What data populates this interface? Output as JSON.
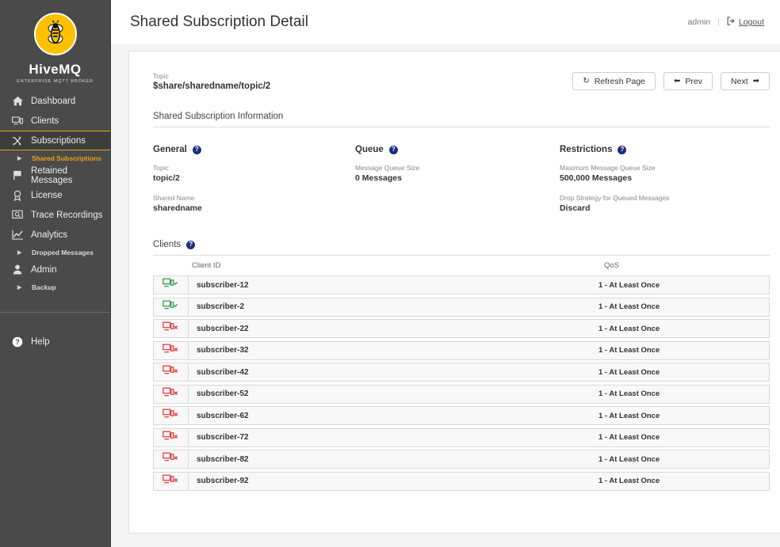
{
  "brand": {
    "name": "HiveMQ",
    "tagline": "ENTERPRISE MQTT BROKER",
    "logo_icon": "bee-logo-icon"
  },
  "sidebar": {
    "items": [
      {
        "label": "Dashboard",
        "icon": "home-icon",
        "active": false
      },
      {
        "label": "Clients",
        "icon": "monitor-icon",
        "active": false
      },
      {
        "label": "Subscriptions",
        "icon": "shuffle-icon",
        "active": true
      },
      {
        "label": "Retained Messages",
        "icon": "flag-icon",
        "active": false
      },
      {
        "label": "License",
        "icon": "award-icon",
        "active": false
      },
      {
        "label": "Trace Recordings",
        "icon": "search-document-icon",
        "active": false
      },
      {
        "label": "Analytics",
        "icon": "chart-line-icon",
        "active": false
      },
      {
        "label": "Admin",
        "icon": "user-icon",
        "active": false
      }
    ],
    "sub_shared_subscriptions": "Shared Subscriptions",
    "sub_dropped_messages": "Dropped Messages",
    "sub_backup": "Backup",
    "help": {
      "label": "Help",
      "icon": "help-circle-icon"
    },
    "accent_color": "#e8a317",
    "background_color": "#4a4a4a"
  },
  "header": {
    "title": "Shared Subscription Detail",
    "user": "admin",
    "separator": "|",
    "logout": "Logout",
    "logout_icon": "sign-out-icon"
  },
  "detail": {
    "topic_label": "Topic",
    "topic_value": "$share/sharedname/topic/2",
    "section_title": "Shared Subscription Information"
  },
  "toolbar": {
    "refresh_label": "Refresh Page",
    "refresh_icon": "refresh-icon",
    "prev_label": "Prev",
    "prev_icon": "arrow-left-icon",
    "next_label": "Next",
    "next_icon": "arrow-right-icon"
  },
  "general": {
    "title": "General",
    "help_icon": "help-circle-icon",
    "topic_label": "Topic",
    "topic_value": "topic/2",
    "shared_name_label": "Shared Name",
    "shared_name_value": "sharedname"
  },
  "queue": {
    "title": "Queue",
    "help_icon": "help-circle-icon",
    "message_queue_size_label": "Message Queue Size",
    "message_queue_size_value": "0 Messages"
  },
  "restrictions": {
    "title": "Restrictions",
    "help_icon": "help-circle-icon",
    "max_queue_size_label": "Maximum Message Queue Size",
    "max_queue_size_value": "500,000 Messages",
    "drop_strategy_label": "Drop Strategy for Queued Messages",
    "drop_strategy_value": "Discard"
  },
  "clients": {
    "title": "Clients",
    "help_icon": "help-circle-icon",
    "columns": {
      "client_id": "Client ID",
      "qos": "QoS"
    },
    "rows": [
      {
        "status": "connected",
        "status_icon": "device-connected-icon",
        "client_id": "subscriber-12",
        "qos": "1 - At Least Once"
      },
      {
        "status": "connected",
        "status_icon": "device-connected-icon",
        "client_id": "subscriber-2",
        "qos": "1 - At Least Once"
      },
      {
        "status": "disconnected",
        "status_icon": "device-disconnected-icon",
        "client_id": "subscriber-22",
        "qos": "1 - At Least Once"
      },
      {
        "status": "disconnected",
        "status_icon": "device-disconnected-icon",
        "client_id": "subscriber-32",
        "qos": "1 - At Least Once"
      },
      {
        "status": "disconnected",
        "status_icon": "device-disconnected-icon",
        "client_id": "subscriber-42",
        "qos": "1 - At Least Once"
      },
      {
        "status": "disconnected",
        "status_icon": "device-disconnected-icon",
        "client_id": "subscriber-52",
        "qos": "1 - At Least Once"
      },
      {
        "status": "disconnected",
        "status_icon": "device-disconnected-icon",
        "client_id": "subscriber-62",
        "qos": "1 - At Least Once"
      },
      {
        "status": "disconnected",
        "status_icon": "device-disconnected-icon",
        "client_id": "subscriber-72",
        "qos": "1 - At Least Once"
      },
      {
        "status": "disconnected",
        "status_icon": "device-disconnected-icon",
        "client_id": "subscriber-82",
        "qos": "1 - At Least Once"
      },
      {
        "status": "disconnected",
        "status_icon": "device-disconnected-icon",
        "client_id": "subscriber-92",
        "qos": "1 - At Least Once"
      }
    ],
    "connected_color": "#2e9e4f",
    "disconnected_color": "#e23b3b"
  }
}
